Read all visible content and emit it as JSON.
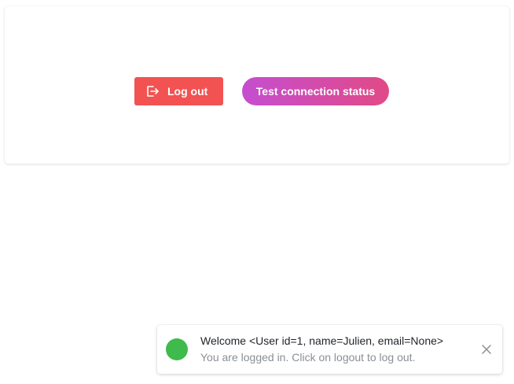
{
  "actions": {
    "logout_label": "Log out",
    "test_label": "Test connection status",
    "logout_color": "#f25252",
    "test_gradient": [
      "#c54ed0",
      "#e14a86"
    ]
  },
  "notification": {
    "title": "Welcome <User id=1, name=Julien, email=None>",
    "message": "You are logged in. Click on logout to log out.",
    "status_color": "#3fba4d"
  },
  "icons": {
    "logout": "logout-icon",
    "close": "close-icon"
  }
}
